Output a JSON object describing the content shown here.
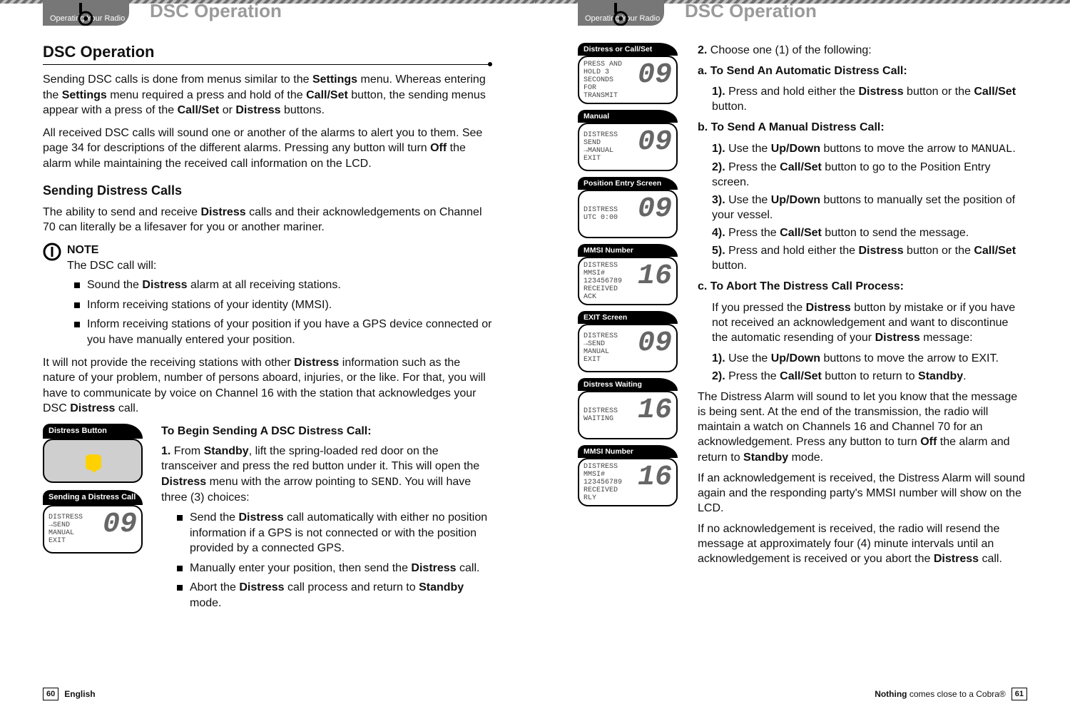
{
  "header": {
    "tab": "Operating Your Radio",
    "title": "DSC Operation"
  },
  "left": {
    "section": "DSC Operation",
    "p1a": "Sending DSC calls is done from menus similar to the ",
    "p1b": "Settings",
    "p1c": " menu. Whereas entering the ",
    "p1d": "Settings",
    "p1e": " menu required a press and hold of the ",
    "p1f": "Call/Set",
    "p1g": " button, the sending menus appear with a press of the ",
    "p1h": "Call/Set",
    "p1i": " or ",
    "p1j": "Distress",
    "p1k": " buttons.",
    "p2a": "All received DSC calls will sound one or another of the alarms to alert you to them. See page 34 for descriptions of the different alarms. Pressing any button will turn ",
    "p2b": "Off",
    "p2c": " the alarm while maintaining the received call information on the LCD.",
    "sub1": "Sending Distress Calls",
    "p3a": "The ability to send and receive ",
    "p3b": "Distress",
    "p3c": " calls and their acknowledgements on Channel 70 can literally be a lifesaver for you or another mariner.",
    "note": {
      "title": "NOTE",
      "line": "The DSC call will:"
    },
    "bullets": {
      "b1a": "Sound the ",
      "b1b": "Distress",
      "b1c": " alarm at all receiving stations.",
      "b2": "Inform receiving stations of your identity (MMSI).",
      "b3": "Inform receiving stations of your position if you have a GPS device connected or you have manually entered your position."
    },
    "p4a": "It will not provide the receiving stations with other ",
    "p4b": "Distress",
    "p4c": " information such as the nature of your problem, number of persons aboard, injuries, or the like. For that, you will have to communicate by voice on Channel 16 with the station that acknowledges your DSC ",
    "p4d": "Distress",
    "p4e": " call.",
    "captions": {
      "c1": "Distress Button",
      "c2": "Sending a Distress Call"
    },
    "screen1": {
      "l1": "DISTRESS",
      "l2": "→SEND",
      "l3": "MANUAL",
      "l4": "EXIT",
      "num": "09"
    },
    "steps": {
      "h": "To Begin Sending A DSC Distress Call:",
      "s1n": "1.",
      "s1a": " From ",
      "s1b": "Standby",
      "s1c": ", lift the spring-loaded red door on the transceiver and press the red button under it. This will open the ",
      "s1d": "Distress",
      "s1e": " menu with the arrow pointing to ",
      "s1f": "SEND",
      "s1g": ". You will have three (3) choices:",
      "b1a": "Send the ",
      "b1b": "Distress",
      "b1c": " call automatically with either no position information if a GPS is not connected or with the position provided by a connected GPS.",
      "b2a": "Manually enter your position, then send the ",
      "b2b": "Distress",
      "b2c": " call.",
      "b3a": "Abort the ",
      "b3b": "Distress",
      "b3c": " call process and return to ",
      "b3d": "Standby",
      "b3e": " mode."
    }
  },
  "right": {
    "captions": {
      "c1": "Distress or Call/Set",
      "c2": "Manual",
      "c3": "Position Entry Screen",
      "c4": "MMSI Number",
      "c5": "EXIT Screen",
      "c6": "Distress Waiting",
      "c7": "MMSI Number"
    },
    "screens": {
      "s1": {
        "l1": "PRESS AND",
        "l2": "HOLD 3",
        "l3": "SECONDS",
        "l4": "FOR",
        "l5": "TRANSMIT",
        "num": "09"
      },
      "s2": {
        "l1": "DISTRESS",
        "l2": " SEND",
        "l3": "→MANUAL",
        "l4": " EXIT",
        "num": "09"
      },
      "s3": {
        "l1": "DISTRESS",
        "l2": "UTC 0:00",
        "num": "09"
      },
      "s4": {
        "l1": "DISTRESS",
        "l2": "MMSI#",
        "l3": "123456789",
        "l4": "RECEIVED",
        "l5": "ACK",
        "num": "16"
      },
      "s5": {
        "l1": " DISTRESS",
        "l2": "→SEND",
        "l3": " MANUAL",
        "l4": " EXIT",
        "num": "09"
      },
      "s6": {
        "l1": "DISTRESS",
        "l2": " ",
        "l3": "WAITING",
        "num": "16"
      },
      "s7": {
        "l1": "DISTRESS",
        "l2": "MMSI#",
        "l3": "123456789",
        "l4": "RECEIVED",
        "l5": "RLY",
        "num": "16"
      }
    },
    "text": {
      "t0n": "2.",
      "t0": " Choose one (1) of the following:",
      "aH": "a. To Send An Automatic Distress Call:",
      "a1n": "1).",
      "a1a": " Press and hold either the ",
      "a1b": "Distress",
      "a1c": " button or the ",
      "a1d": "Call/Set",
      "a1e": " button.",
      "bH": "b. To Send A Manual Distress Call:",
      "b1n": "1).",
      "b1a": " Use the ",
      "b1b": "Up/Down",
      "b1c": " buttons to move the arrow to ",
      "b1d": "MANUAL",
      "b1e": ".",
      "b2n": "2).",
      "b2a": " Press the ",
      "b2b": "Call/Set",
      "b2c": " button to go to the Position Entry screen.",
      "b3n": "3).",
      "b3a": " Use the ",
      "b3b": "Up/Down",
      "b3c": " buttons to manually set the position of your vessel.",
      "b4n": "4).",
      "b4a": " Press the ",
      "b4b": "Call/Set",
      "b4c": " button to send the message.",
      "b5n": "5).",
      "b5a": " Press and hold either the ",
      "b5b": "Distress",
      "b5c": " button or the ",
      "b5d": "Call/Set",
      "b5e": " button.",
      "cH": "c. To Abort The Distress Call Process:",
      "c0a": "If you pressed the ",
      "c0b": "Distress",
      "c0c": " button by mistake or if you have not received an acknowledgement and want to discontinue the automatic resending of your ",
      "c0d": "Distress",
      "c0e": " message:",
      "c1n": "1).",
      "c1a": " Use the ",
      "c1b": "Up/Down",
      "c1c": " buttons to move the arrow to EXIT.",
      "c2n": "2).",
      "c2a": " Press the ",
      "c2b": "Call/Set",
      "c2c": " button to return to ",
      "c2d": "Standby",
      "c2e": ".",
      "p1a": "The Distress Alarm will sound to let you know that the message is being sent. At the end of the transmission, the radio will maintain a watch on Channels 16 and Channel 70 for an acknowledgement. Press any button to turn ",
      "p1b": "Off",
      "p1c": " the alarm and return to ",
      "p1d": "Standby",
      "p1e": " mode.",
      "p2": "If an acknowledgement is received, the Distress Alarm will sound again and the responding party's MMSI number will show on the LCD.",
      "p3a": "If no acknowledgement is received, the radio will resend the message at approximately four (4) minute intervals until an acknowledgement is received or you abort the ",
      "p3b": "Distress",
      "p3c": " call."
    }
  },
  "footer": {
    "left_num": "60",
    "left_lang": "English",
    "right_a": "Nothing",
    "right_b": " comes close to a Cobra®",
    "right_num": "61"
  }
}
